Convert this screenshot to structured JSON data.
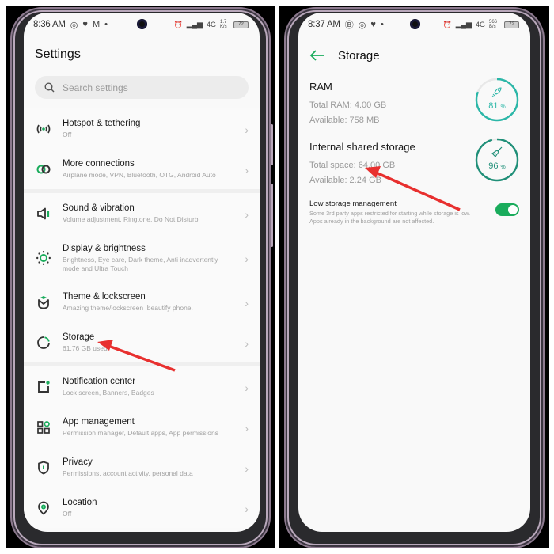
{
  "left_screen": {
    "status_bar": {
      "time": "8:36 AM",
      "notification_icons": [
        "whatsapp-icon",
        "twitter-icon",
        "gmail-icon",
        "dot-icon"
      ],
      "network_label": "4G",
      "speed": "1.7 K/s",
      "battery": "72"
    },
    "title": "Settings",
    "search": {
      "placeholder": "Search settings"
    },
    "groups": [
      {
        "items": [
          {
            "icon": "hotspot-icon",
            "label": "Hotspot & tethering",
            "sub": "Off"
          },
          {
            "icon": "link-icon",
            "label": "More connections",
            "sub": "Airplane mode, VPN, Bluetooth, OTG, Android Auto"
          }
        ]
      },
      {
        "items": [
          {
            "icon": "speaker-icon",
            "label": "Sound & vibration",
            "sub": "Volume adjustment, Ringtone, Do Not Disturb"
          },
          {
            "icon": "brightness-icon",
            "label": "Display & brightness",
            "sub": "Brightness, Eye care, Dark theme, Anti inadvertently mode and Ultra Touch"
          },
          {
            "icon": "theme-icon",
            "label": "Theme & lockscreen",
            "sub": "Amazing theme/lockscreen ,beautify phone."
          },
          {
            "icon": "storage-icon",
            "label": "Storage",
            "sub": "61.76 GB used"
          }
        ]
      },
      {
        "items": [
          {
            "icon": "notification-icon",
            "label": "Notification center",
            "sub": "Lock screen, Banners, Badges"
          },
          {
            "icon": "apps-icon",
            "label": "App management",
            "sub": "Permission manager, Default apps, App permissions"
          },
          {
            "icon": "shield-icon",
            "label": "Privacy",
            "sub": "Permissions, account activity, personal data"
          },
          {
            "icon": "location-icon",
            "label": "Location",
            "sub": "Off"
          }
        ]
      }
    ]
  },
  "right_screen": {
    "status_bar": {
      "time": "8:37 AM",
      "notification_icons": [
        "b-icon",
        "whatsapp-icon",
        "twitter-icon",
        "dot-icon"
      ],
      "network_label": "4G",
      "speed": "566 B/s",
      "battery": "72"
    },
    "title": "Storage",
    "ram": {
      "heading": "RAM",
      "total": "Total RAM: 4.00 GB",
      "available": "Available: 758 MB",
      "percent": 81,
      "percent_label": "81",
      "percent_unit": "%"
    },
    "internal": {
      "heading": "Internal shared storage",
      "total": "Total space: 64.00 GB",
      "available": "Available: 2.24 GB",
      "percent": 96,
      "percent_label": "96",
      "percent_unit": "%"
    },
    "low_storage": {
      "heading": "Low storage management",
      "description": "Some 3rd party apps restricted for starting while storage is low. Apps already in the background are not affected.",
      "enabled": true
    }
  },
  "colors": {
    "accent_green": "#1aac5c",
    "gauge_ram": "#2bb7a8",
    "gauge_storage": "#1f8f78",
    "annotation_arrow": "#e8302f"
  }
}
